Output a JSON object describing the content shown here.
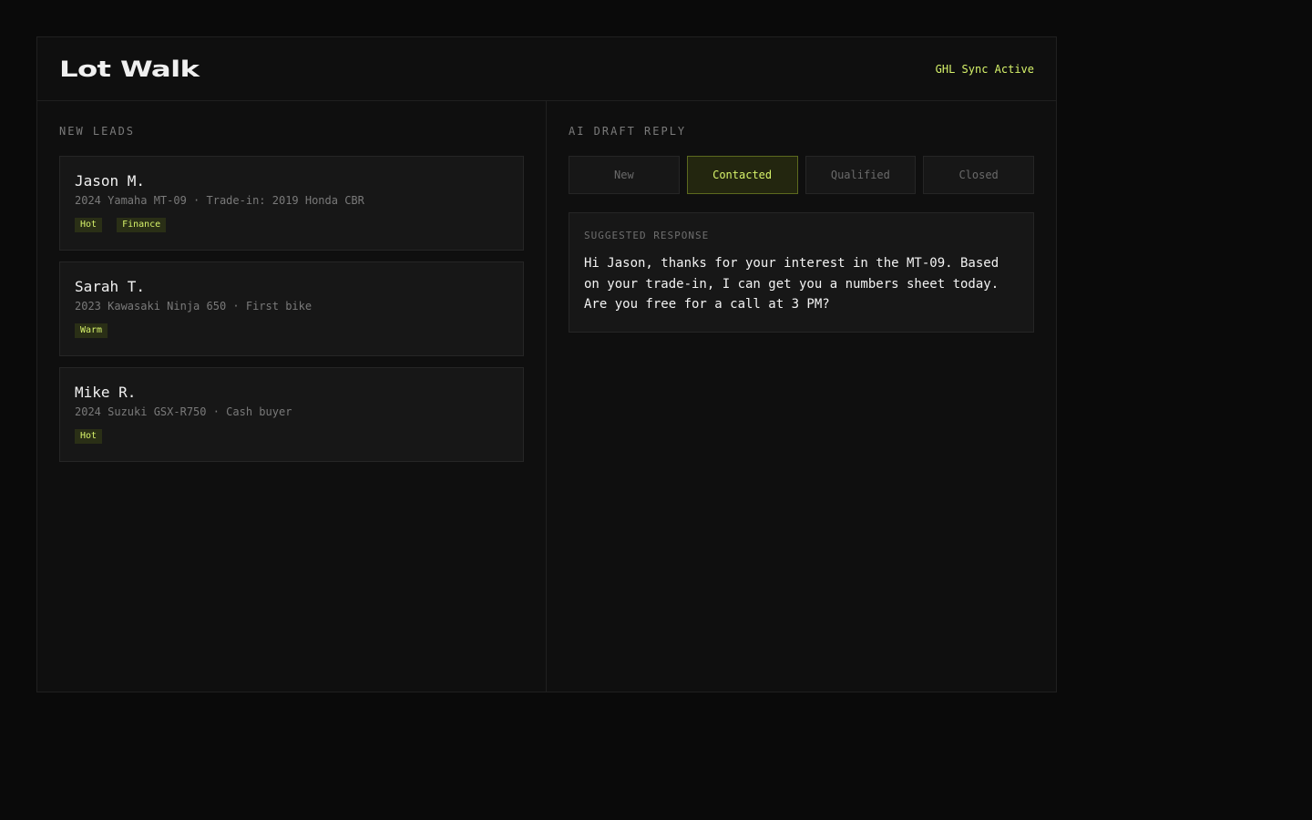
{
  "app": {
    "title": "Lot Walk",
    "sync_status": "GHL Sync Active"
  },
  "leads_panel": {
    "title": "NEW LEADS",
    "leads": [
      {
        "name": "Jason M.",
        "detail": "2024 Yamaha MT-09 · Trade-in: 2019 Honda CBR",
        "tags": [
          "Hot",
          "Finance"
        ]
      },
      {
        "name": "Sarah T.",
        "detail": "2023 Kawasaki Ninja 650 · First bike",
        "tags": [
          "Warm"
        ]
      },
      {
        "name": "Mike R.",
        "detail": "2024 Suzuki GSX-R750 · Cash buyer",
        "tags": [
          "Hot"
        ]
      }
    ]
  },
  "draft_panel": {
    "title": "AI DRAFT REPLY",
    "statuses": [
      "New",
      "Contacted",
      "Qualified",
      "Closed"
    ],
    "active_status": "Contacted",
    "response_label": "SUGGESTED RESPONSE",
    "response_text": "Hi Jason, thanks for your interest in the MT-09. Based on your trade-in, I can get you a numbers sheet today. Are you free for a call at 3 PM?"
  },
  "colors": {
    "accent": "#d6f26a",
    "background": "#0a0a0a",
    "panel": "#0f0f0f",
    "card": "#171717"
  }
}
